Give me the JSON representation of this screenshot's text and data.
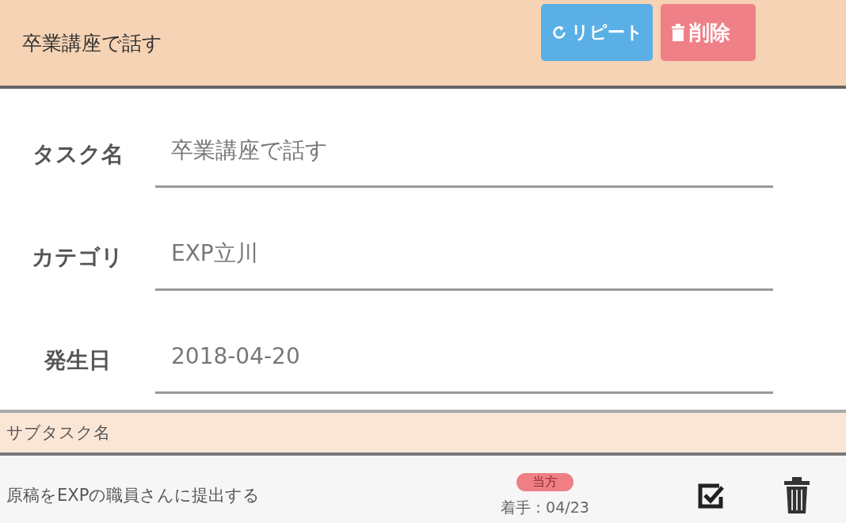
{
  "header": {
    "title": "卒業講座で話す",
    "buttons": [
      {
        "kind": "repeat",
        "label": "リピート"
      },
      {
        "kind": "delete",
        "label": "削除"
      }
    ]
  },
  "form": [
    {
      "label": "タスク名",
      "value": "卒業講座で話す"
    },
    {
      "label": "カテゴリ",
      "value": "EXP立川"
    },
    {
      "label": "発生日",
      "value": "2018-04-20"
    }
  ],
  "subtasks": {
    "heading": "サブタスク名",
    "rows": [
      {
        "name": "原稿をEXPの職員さんに提出する",
        "badge": "当方",
        "start": "着手：04/23"
      }
    ]
  }
}
